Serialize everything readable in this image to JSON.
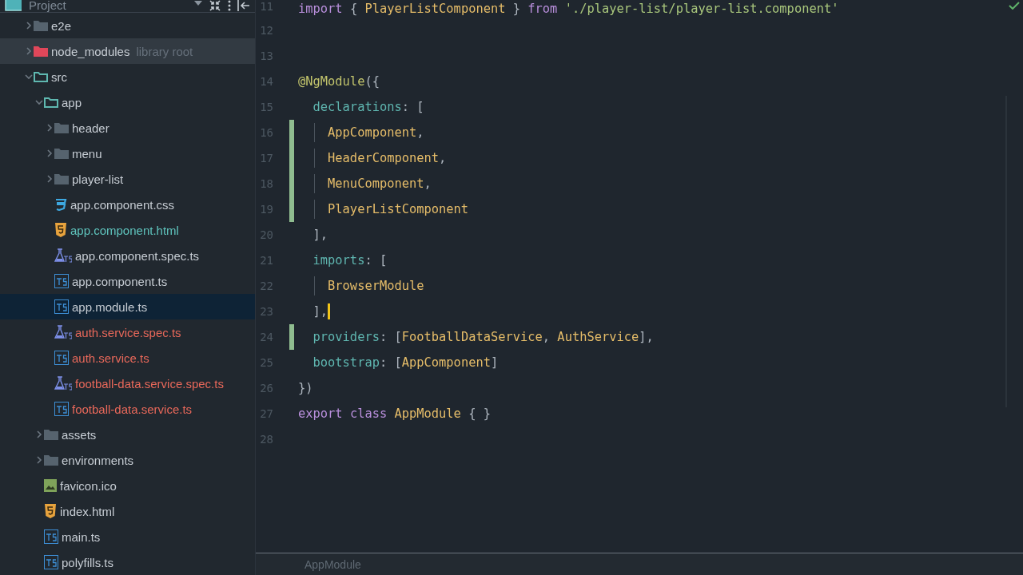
{
  "project_panel": {
    "title": "Project",
    "tree": [
      {
        "label": "e2e",
        "kind": "folder",
        "expanded": false,
        "modified": false,
        "added": false,
        "selected": false
      },
      {
        "label": "node_modules",
        "hint": "library root",
        "kind": "excluded-folder",
        "expanded": false,
        "modified": false,
        "added": false,
        "selected": false,
        "hovered": true
      },
      {
        "label": "src",
        "kind": "source-folder",
        "expanded": true,
        "modified": false,
        "added": false,
        "selected": false,
        "children": [
          {
            "label": "app",
            "kind": "source-folder",
            "expanded": true,
            "modified": false,
            "added": false,
            "selected": false,
            "children": [
              {
                "label": "header",
                "kind": "folder",
                "expanded": false,
                "modified": false,
                "added": false,
                "selected": false
              },
              {
                "label": "menu",
                "kind": "folder",
                "expanded": false,
                "modified": false,
                "added": false,
                "selected": false
              },
              {
                "label": "player-list",
                "kind": "folder",
                "expanded": false,
                "modified": false,
                "added": false,
                "selected": false
              },
              {
                "label": "app.component.css",
                "kind": "css",
                "modified": false,
                "added": false,
                "selected": false
              },
              {
                "label": "app.component.html",
                "kind": "html",
                "modified": true,
                "added": false,
                "selected": false
              },
              {
                "label": "app.component.spec.ts",
                "kind": "spec",
                "modified": false,
                "added": false,
                "selected": false
              },
              {
                "label": "app.component.ts",
                "kind": "ts",
                "modified": false,
                "added": false,
                "selected": false
              },
              {
                "label": "app.module.ts",
                "kind": "ts",
                "modified": false,
                "added": false,
                "selected": true
              },
              {
                "label": "auth.service.spec.ts",
                "kind": "spec",
                "modified": false,
                "added": true,
                "selected": false
              },
              {
                "label": "auth.service.ts",
                "kind": "ts",
                "modified": false,
                "added": true,
                "selected": false
              },
              {
                "label": "football-data.service.spec.ts",
                "kind": "spec",
                "modified": false,
                "added": true,
                "selected": false
              },
              {
                "label": "football-data.service.ts",
                "kind": "ts",
                "modified": false,
                "added": true,
                "selected": false
              }
            ]
          },
          {
            "label": "assets",
            "kind": "folder",
            "expanded": false,
            "modified": false,
            "added": false,
            "selected": false
          },
          {
            "label": "environments",
            "kind": "folder",
            "expanded": false,
            "modified": false,
            "added": false,
            "selected": false
          },
          {
            "label": "favicon.ico",
            "kind": "image",
            "modified": false,
            "added": false,
            "selected": false
          },
          {
            "label": "index.html",
            "kind": "html",
            "modified": false,
            "added": false,
            "selected": false
          },
          {
            "label": "main.ts",
            "kind": "ts",
            "modified": false,
            "added": false,
            "selected": false
          },
          {
            "label": "polyfills.ts",
            "kind": "ts",
            "modified": false,
            "added": false,
            "selected": false
          }
        ]
      }
    ]
  },
  "editor": {
    "lines": [
      {
        "number": "11",
        "changed": false,
        "guide": false,
        "caret": false,
        "tokens": [
          {
            "kind": "kw",
            "t": "import"
          },
          {
            "kind": "punct",
            "t": " { "
          },
          {
            "kind": "cls",
            "t": "PlayerListComponent"
          },
          {
            "kind": "punct",
            "t": " } "
          },
          {
            "kind": "kw",
            "t": "from"
          },
          {
            "kind": "str",
            "t": " './player-list/player-list.component'"
          }
        ]
      },
      {
        "number": "12",
        "changed": false,
        "guide": false,
        "caret": false
      },
      {
        "number": "13",
        "changed": false,
        "guide": false,
        "caret": false
      },
      {
        "number": "14",
        "changed": false,
        "guide": false,
        "caret": false,
        "tokens": [
          {
            "kind": "deco",
            "t": "@NgModule"
          },
          {
            "kind": "punct",
            "t": "({"
          }
        ]
      },
      {
        "number": "15",
        "changed": false,
        "guide": false,
        "caret": false,
        "tokens": [
          {
            "kind": "prop",
            "t": "  declarations"
          },
          {
            "kind": "punct",
            "t": ": ["
          }
        ]
      },
      {
        "number": "16",
        "changed": true,
        "guide": true,
        "caret": false,
        "tokens": [
          {
            "kind": "cls",
            "t": "    AppComponent"
          },
          {
            "kind": "punct",
            "t": ","
          }
        ]
      },
      {
        "number": "17",
        "changed": true,
        "guide": true,
        "caret": false,
        "tokens": [
          {
            "kind": "cls",
            "t": "    HeaderComponent"
          },
          {
            "kind": "punct",
            "t": ","
          }
        ]
      },
      {
        "number": "18",
        "changed": true,
        "guide": true,
        "caret": false,
        "tokens": [
          {
            "kind": "cls",
            "t": "    MenuComponent"
          },
          {
            "kind": "punct",
            "t": ","
          }
        ]
      },
      {
        "number": "19",
        "changed": true,
        "guide": true,
        "caret": false,
        "tokens": [
          {
            "kind": "cls",
            "t": "    PlayerListComponent"
          }
        ]
      },
      {
        "number": "20",
        "changed": false,
        "guide": false,
        "caret": false,
        "tokens": [
          {
            "kind": "punct",
            "t": "  ],"
          }
        ]
      },
      {
        "number": "21",
        "changed": false,
        "guide": false,
        "caret": false,
        "tokens": [
          {
            "kind": "prop",
            "t": "  imports"
          },
          {
            "kind": "punct",
            "t": ": ["
          }
        ]
      },
      {
        "number": "22",
        "changed": false,
        "guide": true,
        "caret": false,
        "tokens": [
          {
            "kind": "cls",
            "t": "    BrowserModule"
          }
        ]
      },
      {
        "number": "23",
        "changed": false,
        "guide": false,
        "caret": true,
        "tokens": [
          {
            "kind": "punct",
            "t": "  ],"
          }
        ]
      },
      {
        "number": "24",
        "changed": true,
        "guide": false,
        "caret": false,
        "tokens": [
          {
            "kind": "prop",
            "t": "  providers"
          },
          {
            "kind": "punct",
            "t": ": ["
          },
          {
            "kind": "cls",
            "t": "FootballDataService"
          },
          {
            "kind": "punct",
            "t": ", "
          },
          {
            "kind": "cls",
            "t": "AuthService"
          },
          {
            "kind": "punct",
            "t": "],"
          }
        ]
      },
      {
        "number": "25",
        "changed": false,
        "guide": false,
        "caret": false,
        "tokens": [
          {
            "kind": "prop",
            "t": "  bootstrap"
          },
          {
            "kind": "punct",
            "t": ": ["
          },
          {
            "kind": "cls",
            "t": "AppComponent"
          },
          {
            "kind": "punct",
            "t": "]"
          }
        ]
      },
      {
        "number": "26",
        "changed": false,
        "guide": false,
        "caret": false,
        "tokens": [
          {
            "kind": "punct",
            "t": "})"
          }
        ]
      },
      {
        "number": "27",
        "changed": false,
        "guide": false,
        "caret": false,
        "tokens": [
          {
            "kind": "kw",
            "t": "export"
          },
          {
            "kind": "kw",
            "t": " class"
          },
          {
            "kind": "cls",
            "t": " AppModule"
          },
          {
            "kind": "punct",
            "t": " { }"
          }
        ]
      },
      {
        "number": "28",
        "changed": false,
        "guide": false,
        "caret": false
      }
    ],
    "breadcrumb": "AppModule"
  }
}
